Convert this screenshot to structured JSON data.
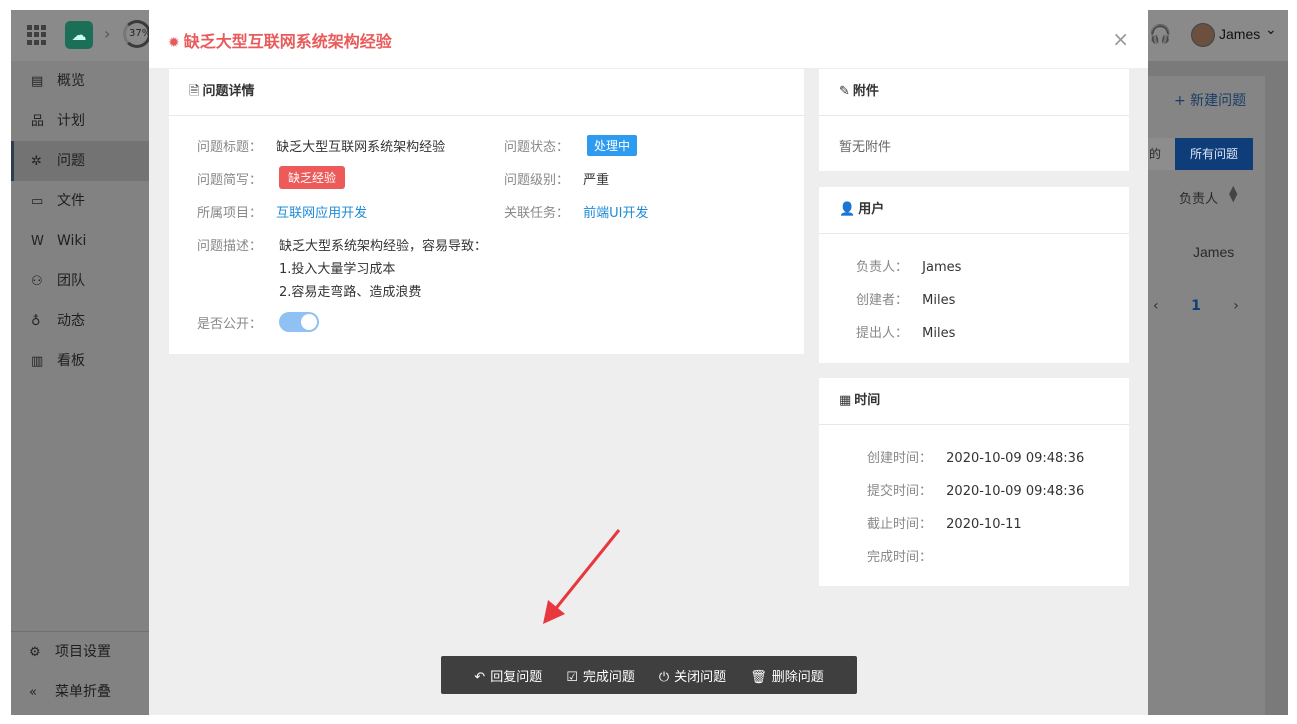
{
  "app": {
    "progress_text": "37%",
    "user_name": "James",
    "icons": {
      "apps": "grid-icon",
      "logo": "cloud-logo",
      "help": "headset-icon"
    }
  },
  "sidebar": {
    "items": [
      {
        "label": "概览",
        "icon": "overview-icon",
        "glyph": "▤"
      },
      {
        "label": "计划",
        "icon": "plan-icon",
        "glyph": "品"
      },
      {
        "label": "问题",
        "icon": "bug-icon",
        "glyph": "✲",
        "active": true
      },
      {
        "label": "文件",
        "icon": "folder-icon",
        "glyph": "▭"
      },
      {
        "label": "Wiki",
        "icon": "wiki-icon",
        "glyph": "W"
      },
      {
        "label": "团队",
        "icon": "team-icon",
        "glyph": "⚇"
      },
      {
        "label": "动态",
        "icon": "activity-icon",
        "glyph": "♁"
      },
      {
        "label": "看板",
        "icon": "chart-icon",
        "glyph": "▥"
      }
    ],
    "bottom": [
      {
        "label": "项目设置",
        "icon": "gear-icon",
        "glyph": "⚙"
      },
      {
        "label": "菜单折叠",
        "icon": "collapse-icon",
        "glyph": "«"
      }
    ]
  },
  "background_list": {
    "new_issue": "+ 新建问题",
    "tab_mine": "的",
    "tab_all": "所有问题",
    "column_owner": "负责人",
    "row_owner": "James",
    "page_num": "1"
  },
  "modal": {
    "title": "缺乏大型互联网系统架构经验",
    "close": "×",
    "detail": {
      "heading": "问题详情",
      "title_label": "问题标题：",
      "title_value": "缺乏大型互联网系统架构经验",
      "status_label": "问题状态：",
      "status_value": "处理中",
      "short_label": "问题简写：",
      "short_value": "缺乏经验",
      "level_label": "问题级别：",
      "level_value": "严重",
      "project_label": "所属项目：",
      "project_value": "互联网应用开发",
      "task_label": "关联任务：",
      "task_value": "前端UI开发",
      "desc_label": "问题描述：",
      "desc_lines": [
        "缺乏大型系统架构经验，容易导致：",
        "1.投入大量学习成本",
        "2.容易走弯路、造成浪费"
      ],
      "public_label": "是否公开：",
      "public_on": true
    },
    "attachment": {
      "heading": "附件",
      "empty": "暂无附件"
    },
    "users": {
      "heading": "用户",
      "owner_label": "负责人：",
      "owner": "James",
      "creator_label": "创建者：",
      "creator": "Miles",
      "reporter_label": "提出人：",
      "reporter": "Miles"
    },
    "time": {
      "heading": "时间",
      "created_label": "创建时间：",
      "created": "2020-10-09 09:48:36",
      "submitted_label": "提交时间：",
      "submitted": "2020-10-09 09:48:36",
      "deadline_label": "截止时间：",
      "deadline": "2020-10-11",
      "finished_label": "完成时间：",
      "finished": ""
    },
    "actions": {
      "reply": "回复问题",
      "complete": "完成问题",
      "close": "关闭问题",
      "delete": "删除问题"
    }
  },
  "colors": {
    "title_red": "#e95b5b",
    "link_blue": "#1c8bd6",
    "status_blue": "#2d9cf0",
    "badge_red": "#ed5a5a",
    "action_bar": "#3f3f3f",
    "arrow_red": "#e8383d"
  }
}
